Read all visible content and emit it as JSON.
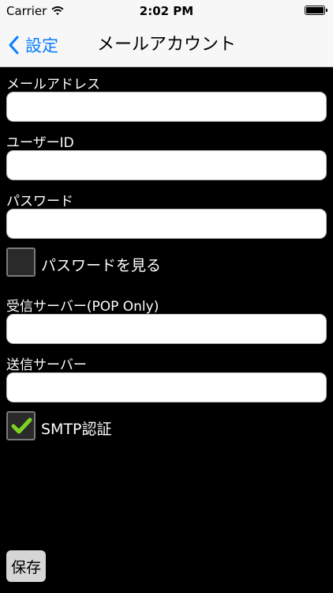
{
  "status": {
    "carrier": "Carrier",
    "time": "2:02 PM"
  },
  "nav": {
    "back_label": "設定",
    "title": "メールアカウント"
  },
  "form": {
    "email_label": "メールアドレス",
    "email_value": "",
    "userid_label": "ユーザーID",
    "userid_value": "",
    "password_label": "パスワード",
    "password_value": "",
    "show_password_label": "パスワードを見る",
    "show_password_checked": false,
    "incoming_label": "受信サーバー(POP Only)",
    "incoming_value": "",
    "outgoing_label": "送信サーバー",
    "outgoing_value": "",
    "smtp_auth_label": "SMTP認証",
    "smtp_auth_checked": true
  },
  "toolbar": {
    "save_label": "保存"
  },
  "colors": {
    "accent": "#0a7cff",
    "check": "#7ed321"
  }
}
